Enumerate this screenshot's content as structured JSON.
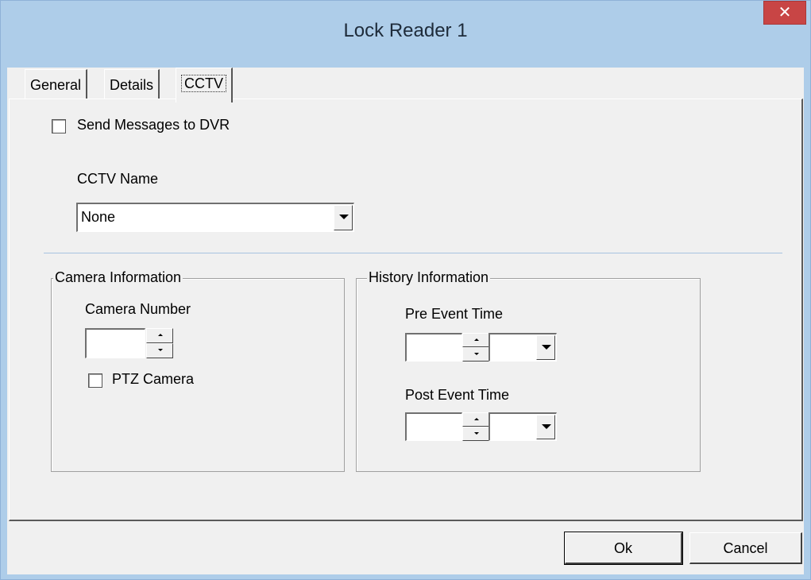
{
  "window": {
    "title": "Lock Reader 1",
    "close_glyph": "✕"
  },
  "tabs": [
    {
      "label": "General",
      "active": false
    },
    {
      "label": "Details",
      "active": false
    },
    {
      "label": "CCTV",
      "active": true
    }
  ],
  "cctv": {
    "send_messages_label": "Send Messages to DVR",
    "send_messages_checked": false,
    "cctv_name_label": "CCTV Name",
    "cctv_name_value": "None"
  },
  "camera_info": {
    "title": "Camera Information",
    "camera_number_label": "Camera Number",
    "camera_number_value": "",
    "ptz_label": "PTZ Camera",
    "ptz_checked": false
  },
  "history_info": {
    "title": "History Information",
    "pre_event_label": "Pre Event Time",
    "pre_event_value": "",
    "pre_event_unit": "",
    "post_event_label": "Post Event Time",
    "post_event_value": "",
    "post_event_unit": ""
  },
  "buttons": {
    "ok": "Ok",
    "cancel": "Cancel"
  },
  "colors": {
    "titlebar": "#aecde9",
    "close_button": "#c84545",
    "dialog_face": "#f0f0f0"
  },
  "icons": [
    "close-icon",
    "dropdown-arrow-icon",
    "spin-up-icon",
    "spin-down-icon"
  ]
}
